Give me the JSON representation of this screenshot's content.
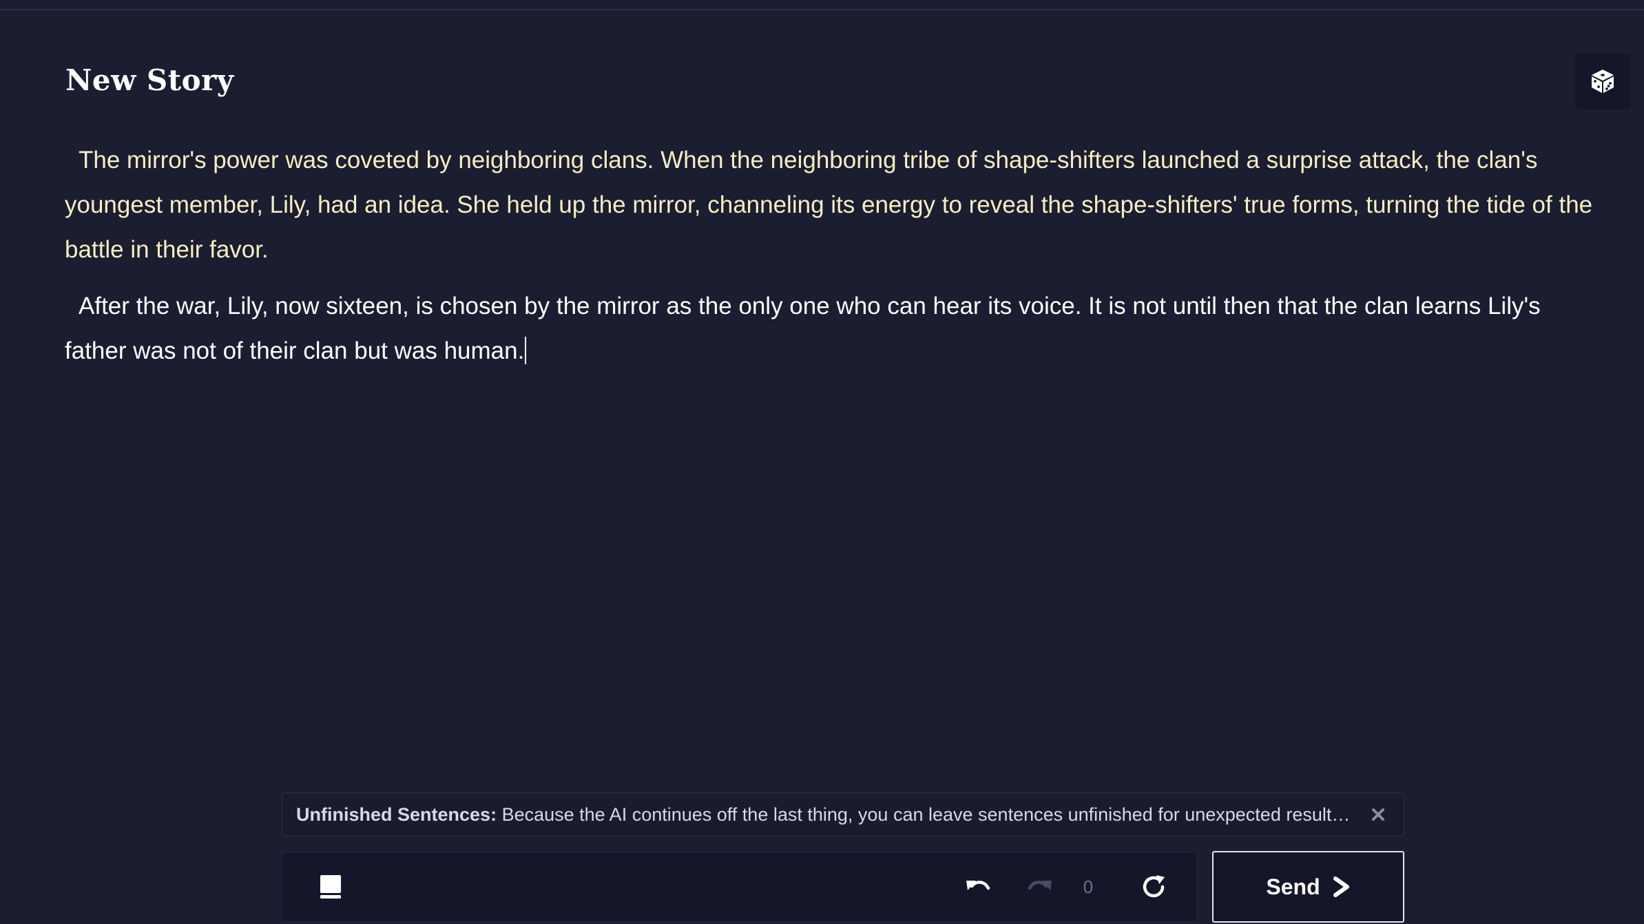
{
  "story": {
    "title": "New Story",
    "paragraphs": [
      {
        "text": "The mirror's power was coveted by neighboring clans. When the neighboring tribe of shape-shifters launched a surprise attack, the clan's youngest member, Lily, had an idea. She held up the mirror, channeling its energy to reveal the shape-shifters' true forms, turning the tide of the battle in their favor.",
        "source": "ai"
      },
      {
        "text": "After the war, Lily, now sixteen, is chosen by the mirror as the only one who can hear its voice. It is not until then that the clan learns Lily's father was not of their clan but was human.",
        "source": "user"
      }
    ]
  },
  "header": {
    "random_icon": "dice-icon"
  },
  "tip": {
    "label": "Unfinished Sentences:",
    "text": " Because the AI continues off the last thing, you can leave sentences unfinished for unexpected results. Try it out and see what you get!",
    "close_icon": "close-icon"
  },
  "toolbar": {
    "book_icon": "book-icon",
    "undo_icon": "undo-icon",
    "redo_icon": "redo-icon",
    "history_count": "0",
    "retry_icon": "retry-icon"
  },
  "send": {
    "label": "Send",
    "icon": "chevron-right-icon"
  },
  "colors": {
    "background": "#1b1d30",
    "panel": "#14162a",
    "ai_text": "#f5eec2",
    "user_text": "#ffffff"
  }
}
